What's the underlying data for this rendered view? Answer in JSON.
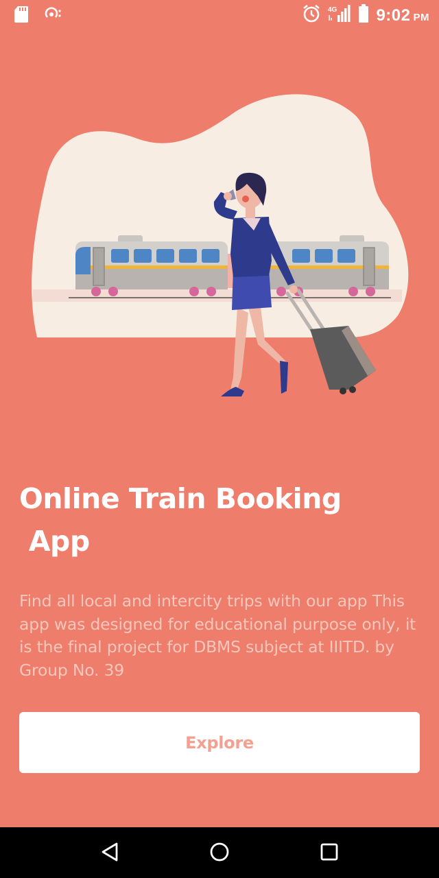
{
  "status_bar": {
    "time": "9:02",
    "ampm": "PM",
    "network": "4G",
    "icons": [
      "sd-card-icon",
      "hotspot-icon",
      "alarm-icon",
      "signal-icon",
      "battery-icon"
    ]
  },
  "main": {
    "title": "Online Train Booking\n App",
    "description": "Find all local and intercity trips with our app This app was designed for educational purpose only, it is the final project for DBMS subject at IIITD. by Group No. 39",
    "explore_label": "Explore"
  },
  "nav_bar": {
    "icons": [
      "back-icon",
      "home-icon",
      "recents-icon"
    ]
  },
  "colors": {
    "background": "#EF7D6B",
    "blob": "#F8EDE2",
    "button_text": "#F4A091",
    "description_text": "#F6C7BD"
  }
}
